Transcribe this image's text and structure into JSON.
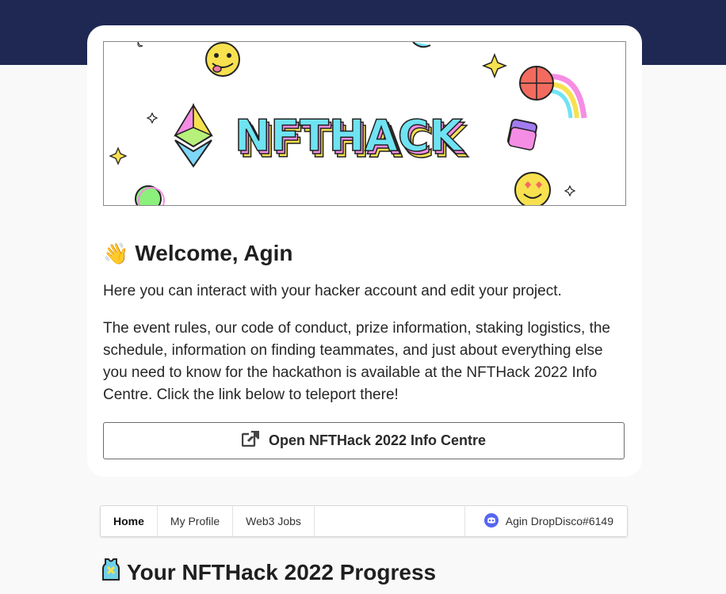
{
  "banner": {
    "logo_text": "NFTHACK"
  },
  "welcome": {
    "emoji": "👋",
    "title": "Welcome, Agin",
    "intro": "Here you can interact with your hacker account and edit your project.",
    "details": "The event rules, our code of conduct, prize information, staking logistics, the schedule, information on finding teammates, and just about everything else you need to know for the hackathon is available at the NFTHack 2022 Info Centre. Click the link below to teleport there!"
  },
  "info_button": {
    "icon": "external-link-icon",
    "label": "Open NFTHack 2022 Info Centre"
  },
  "nav": {
    "tabs": [
      {
        "label": "Home",
        "active": true
      },
      {
        "label": "My Profile",
        "active": false
      },
      {
        "label": "Web3 Jobs",
        "active": false
      }
    ],
    "user": {
      "icon": "discord-icon",
      "label": "Agin DropDisco#6149"
    }
  },
  "progress": {
    "icon": "jersey-icon",
    "title": "Your NFTHack 2022 Progress"
  },
  "colors": {
    "header_bg": "#1e2853",
    "discord": "#5865f2"
  }
}
